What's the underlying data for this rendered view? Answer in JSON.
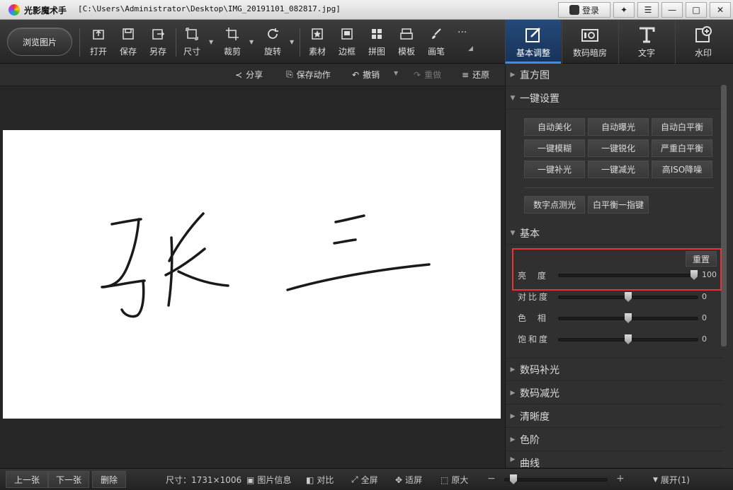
{
  "window": {
    "app_name": "光影魔术手",
    "file_path": "[C:\\Users\\Administrator\\Desktop\\IMG_20191101_082817.jpg]",
    "login_label": "登录"
  },
  "toolbar": {
    "browse_label": "浏览图片",
    "tools": [
      "打开",
      "保存",
      "另存",
      "尺寸",
      "裁剪",
      "旋转",
      "素材",
      "边框",
      "拼图",
      "模板",
      "画笔"
    ],
    "more_label": "···"
  },
  "tabs": [
    "基本调整",
    "数码暗房",
    "文字",
    "水印"
  ],
  "subbar": {
    "share": "分享",
    "save_action": "保存动作",
    "undo": "撤销",
    "redo": "重做",
    "restore": "还原"
  },
  "image": {
    "handwriting": "张 三"
  },
  "panel": {
    "histogram": "直方图",
    "one_click": "一键设置",
    "one_click_buttons": [
      "自动美化",
      "自动曝光",
      "自动白平衡",
      "一键模糊",
      "一键锐化",
      "严重白平衡",
      "一键补光",
      "一键减光",
      "高ISO降噪"
    ],
    "extra_buttons": [
      "数字点测光",
      "白平衡一指键"
    ],
    "basic": "基本",
    "reset": "重置",
    "sliders": [
      {
        "label": "亮 度",
        "value": "100",
        "level": 1.0
      },
      {
        "label": "对比度",
        "value": "0",
        "level": 0.5
      },
      {
        "label": "色 相",
        "value": "0",
        "level": 0.5
      },
      {
        "label": "饱和度",
        "value": "0",
        "level": 0.5
      }
    ],
    "more_sections": [
      "数码补光",
      "数码减光",
      "清晰度",
      "色阶",
      "曲线"
    ]
  },
  "status": {
    "prev": "上一张",
    "next": "下一张",
    "delete": "删除",
    "size": "尺寸：1731×1006",
    "info": "图片信息",
    "compare": "对比",
    "fullscreen": "全屏",
    "fit": "适屏",
    "original": "原大",
    "zoom_level": 0.05,
    "expand": "展开(1)"
  },
  "colors": {
    "accent": "#3d8bf0",
    "highlight": "#e53535"
  }
}
